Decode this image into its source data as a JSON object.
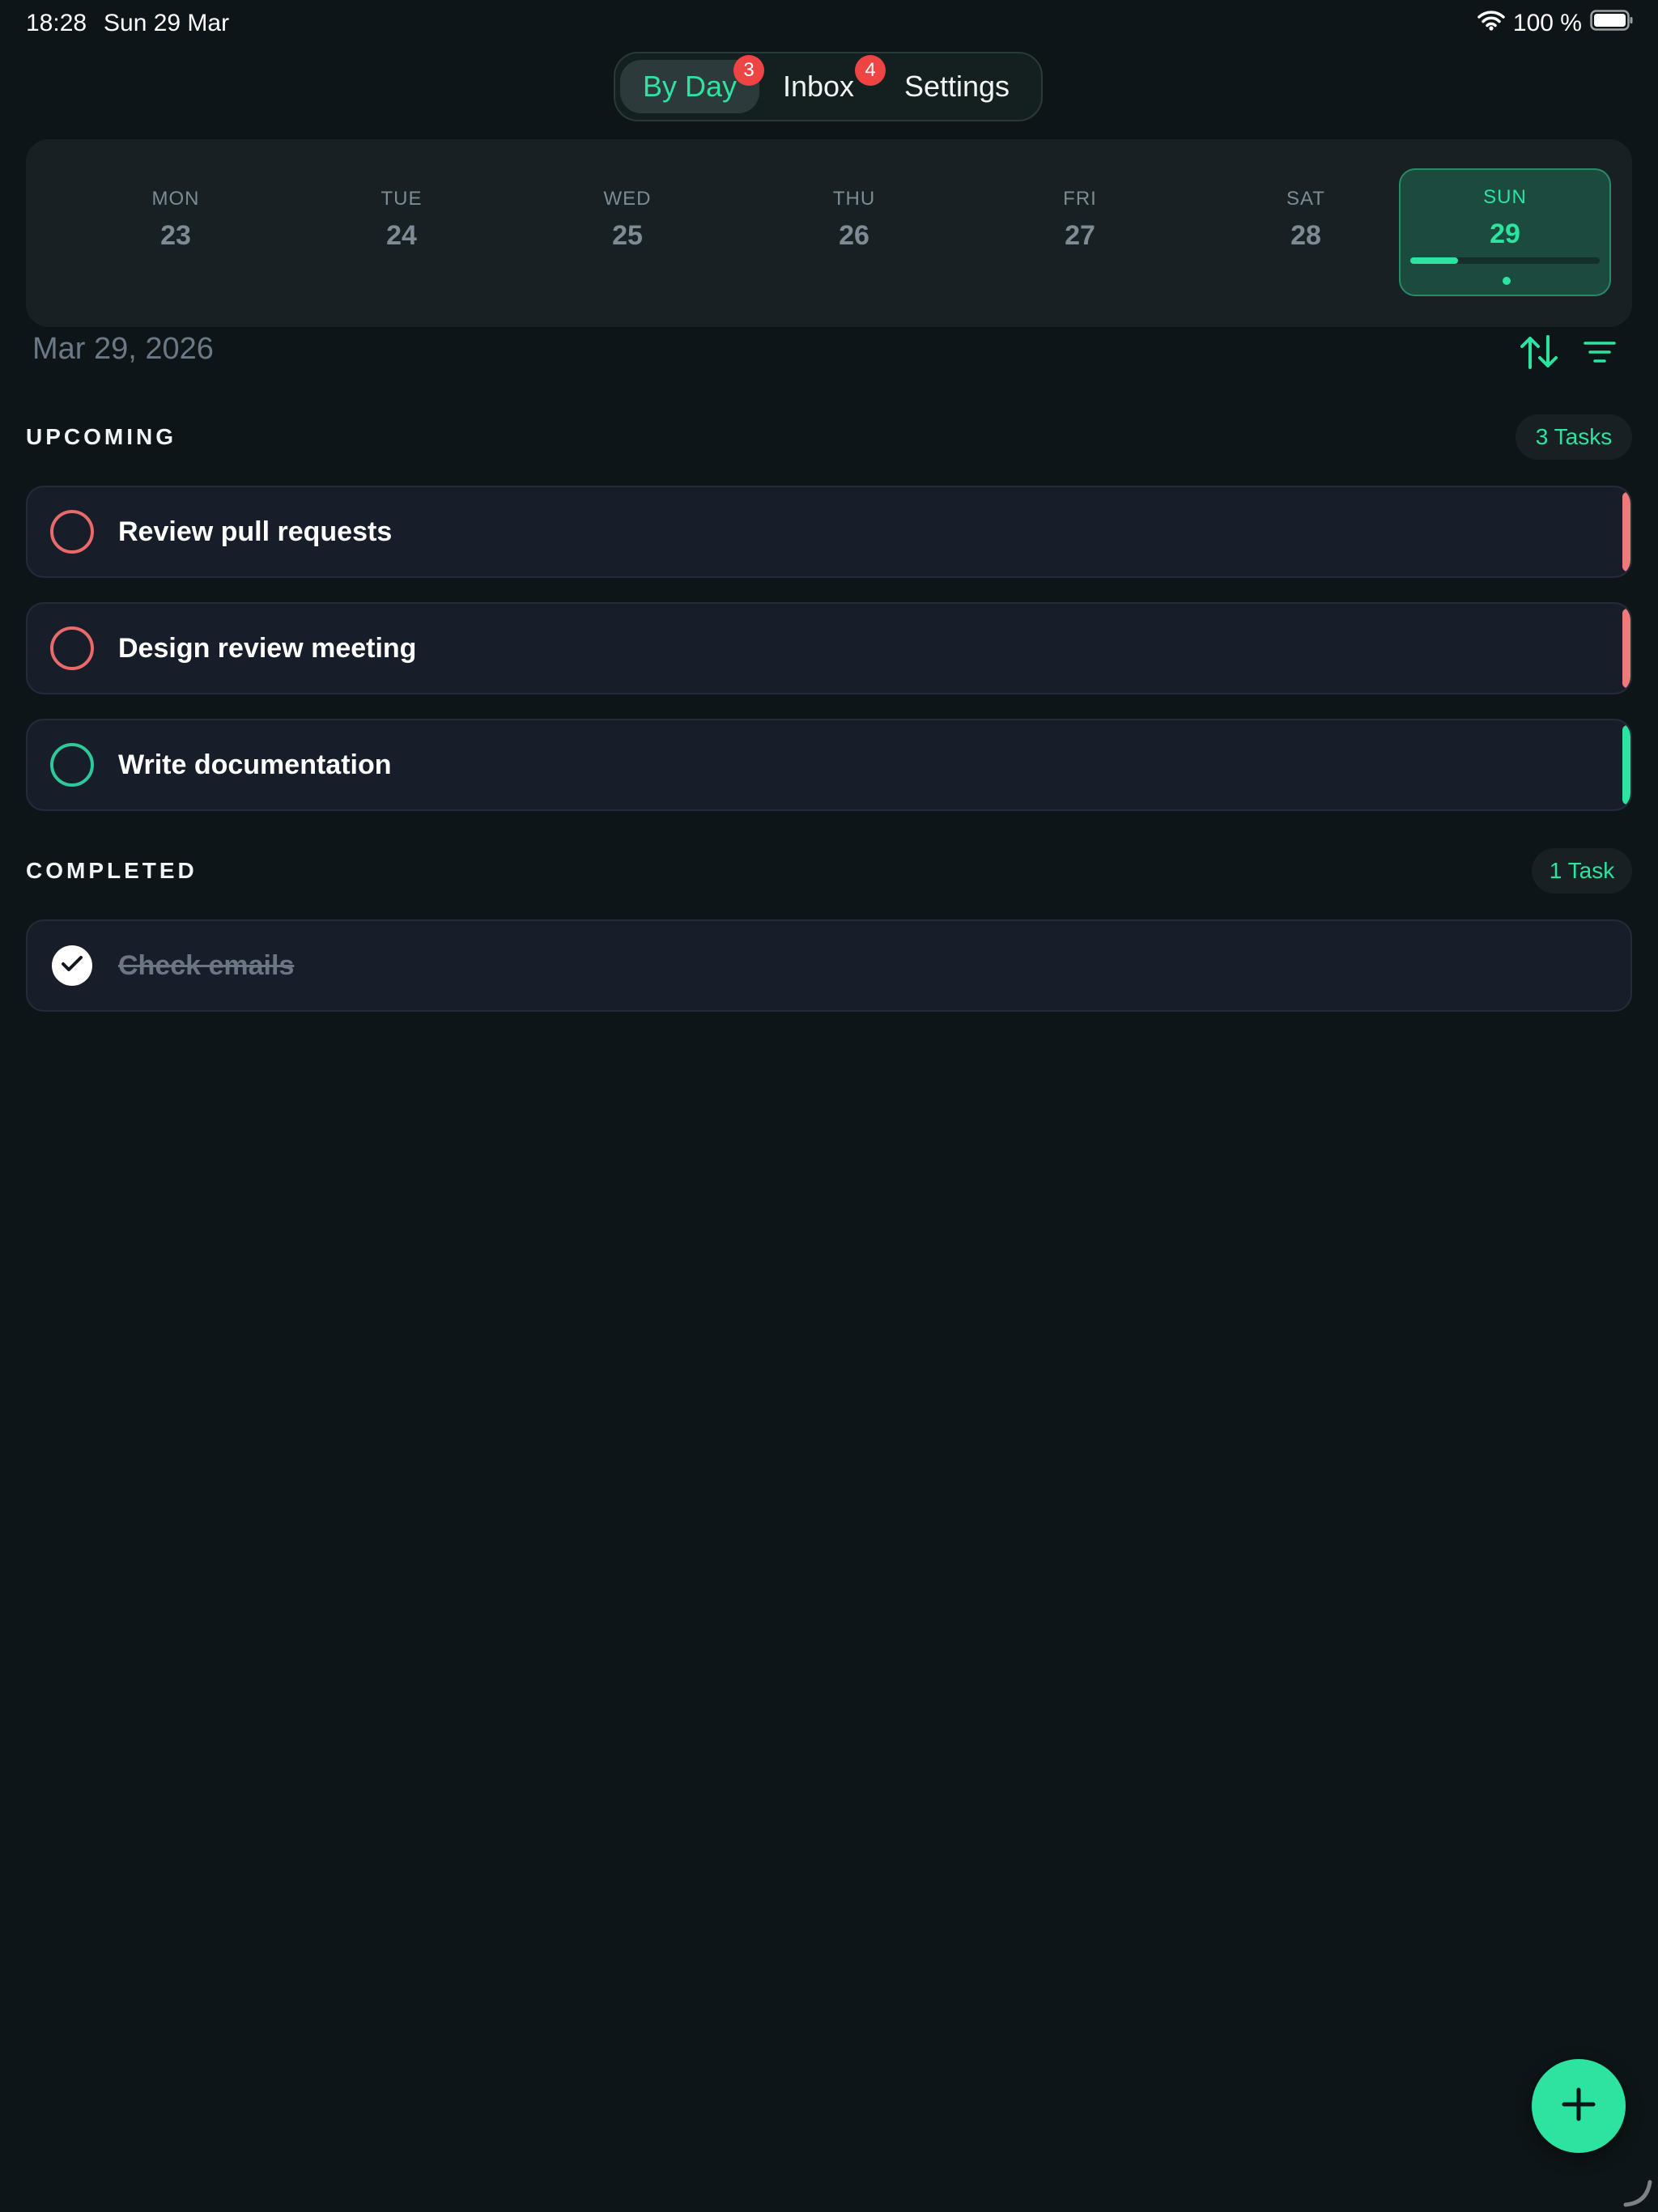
{
  "status_bar": {
    "time": "18:28",
    "date": "Sun 29 Mar",
    "battery": "100 %"
  },
  "tabs": [
    {
      "label": "By Day",
      "badge": "3",
      "active": true
    },
    {
      "label": "Inbox",
      "badge": "4",
      "active": false
    },
    {
      "label": "Settings",
      "active": false
    }
  ],
  "week": [
    {
      "name": "MON",
      "num": "23"
    },
    {
      "name": "TUE",
      "num": "24"
    },
    {
      "name": "WED",
      "num": "25"
    },
    {
      "name": "THU",
      "num": "26"
    },
    {
      "name": "FRI",
      "num": "27"
    },
    {
      "name": "SAT",
      "num": "28"
    },
    {
      "name": "SUN",
      "num": "29",
      "selected": true,
      "progress": 0.25
    }
  ],
  "current_date": "Mar 29, 2026",
  "upcoming": {
    "title": "UPCOMING",
    "count": "3 Tasks",
    "tasks": [
      {
        "label": "Review pull requests",
        "priority_color": "#f07a7a",
        "circle_color": "#e86a6a"
      },
      {
        "label": "Design review meeting",
        "priority_color": "#f07a7a",
        "circle_color": "#e86a6a"
      },
      {
        "label": "Write documentation",
        "priority_color": "#2de3a0",
        "circle_color": "#2ec99a"
      }
    ]
  },
  "completed": {
    "title": "COMPLETED",
    "count": "1 Task",
    "tasks": [
      {
        "label": "Check emails"
      }
    ]
  },
  "colors": {
    "accent": "#2de3a0",
    "background": "#0d1518",
    "card": "#171d29",
    "badge": "#ef4444",
    "high_priority": "#f07a7a"
  },
  "icons": [
    "wifi-icon",
    "battery-icon",
    "sort-icon",
    "filter-icon",
    "checkmark-icon",
    "plus-icon"
  ]
}
